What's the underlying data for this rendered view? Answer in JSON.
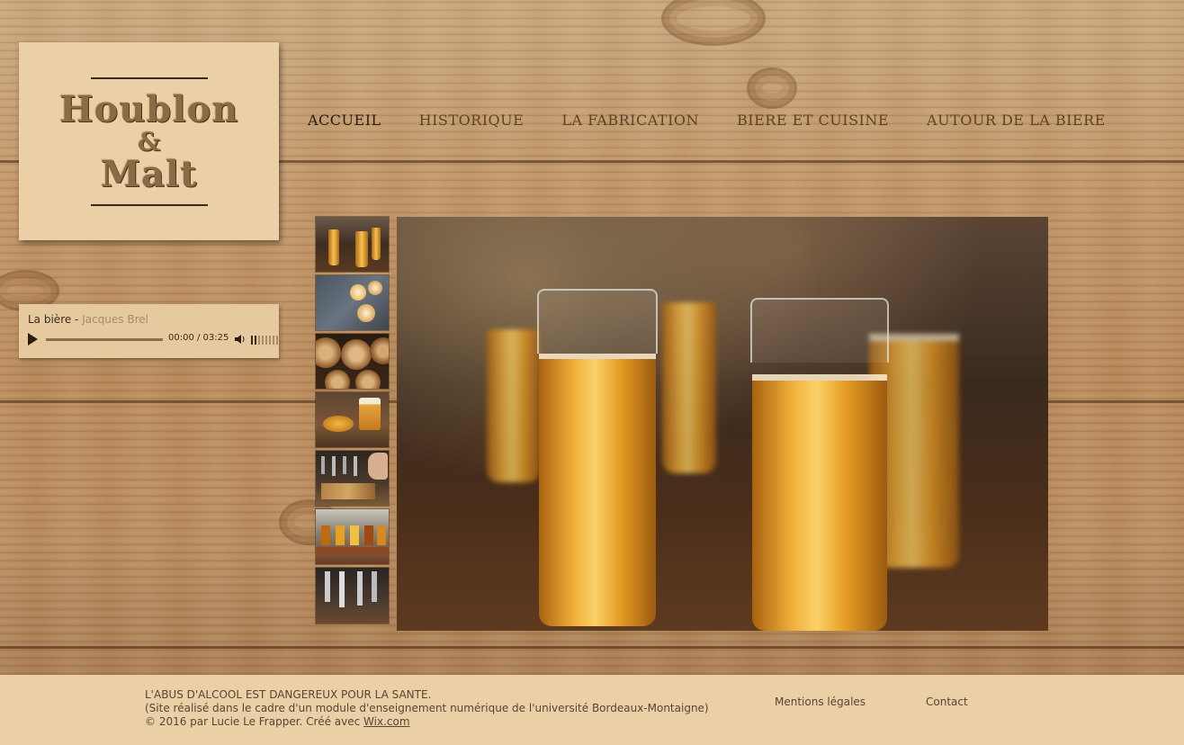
{
  "logo": {
    "line1": "Houblon",
    "amp": "&",
    "line2": "Malt"
  },
  "nav": {
    "items": [
      {
        "label": "ACCUEIL",
        "active": true
      },
      {
        "label": "HISTORIQUE"
      },
      {
        "label": "LA FABRICATION"
      },
      {
        "label": "BIERE ET CUISINE"
      },
      {
        "label": "AUTOUR DE LA BIERE"
      }
    ]
  },
  "player": {
    "song": "La bière - ",
    "artist": "Jacques Brel",
    "time": "00:00 / 03:25",
    "icons": [
      "play-icon",
      "volume-icon",
      "volume-level-icon"
    ]
  },
  "gallery": {
    "thumbnails": [
      "beer-glasses-row",
      "beer-glasses-top-view",
      "barrels",
      "snacks-and-beer",
      "tap-pouring",
      "beer-flight",
      "beer-taps"
    ],
    "main_image": "beer-glasses-on-bar"
  },
  "footer": {
    "line1": "L'ABUS D'ALCOOL EST DANGEREUX POUR LA SANTE.",
    "line2": "(Site réalisé dans le cadre d'un module d'enseignement numérique de l'université Bordeaux-Montaigne)",
    "line3_prefix": "© 2016 par Lucie Le Frapper. Créé avec ",
    "line3_link": "Wix.com",
    "mentions": "Mentions légales",
    "contact": "Contact"
  }
}
